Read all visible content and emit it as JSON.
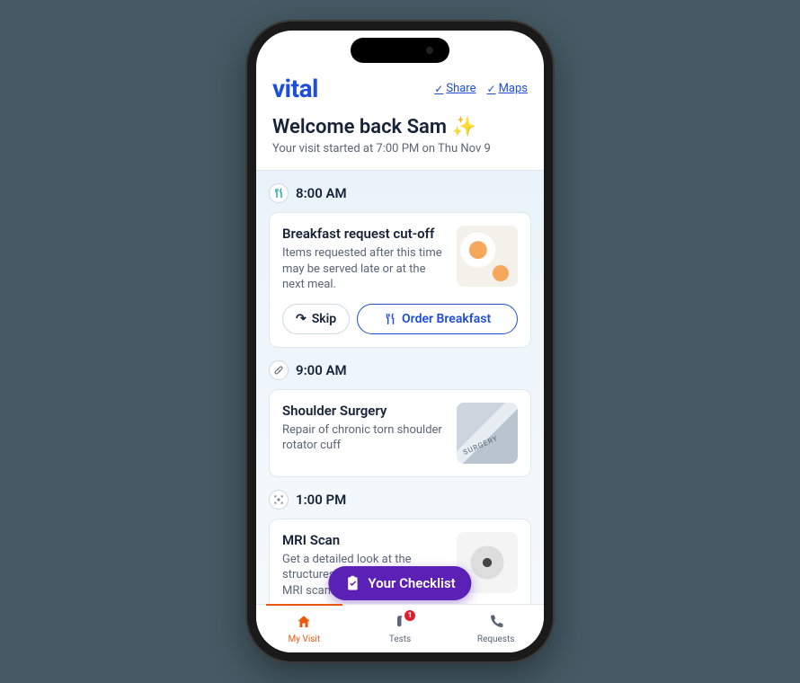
{
  "brand": "vital",
  "header_links": {
    "share": "Share",
    "maps": "Maps"
  },
  "welcome": {
    "heading": "Welcome back Sam ✨",
    "subtext": "Your visit started at 7:00 PM on Thu Nov 9"
  },
  "timeline": [
    {
      "time": "8:00 AM",
      "icon": "utensils",
      "card": {
        "title": "Breakfast request cut-off",
        "desc": "Items requested after this time may be served late or at the next meal.",
        "image": "breakfast",
        "actions": {
          "skip": "Skip",
          "primary": "Order Breakfast"
        }
      }
    },
    {
      "time": "9:00 AM",
      "icon": "bandage",
      "card": {
        "title": "Shoulder Surgery",
        "desc": "Repair of chronic torn shoulder rotator cuff",
        "image": "surgery"
      }
    },
    {
      "time": "1:00 PM",
      "icon": "scan",
      "card": {
        "title": "MRI Scan",
        "desc": "Get a detailed look at the structures and tissues with an MRI scan.",
        "image": "mri"
      }
    }
  ],
  "fab": {
    "label": "Your Checklist"
  },
  "nav": {
    "items": [
      {
        "label": "My Visit",
        "icon": "home",
        "active": true
      },
      {
        "label": "Tests",
        "icon": "vial",
        "badge": "1"
      },
      {
        "label": "Requests",
        "icon": "phone"
      }
    ]
  }
}
